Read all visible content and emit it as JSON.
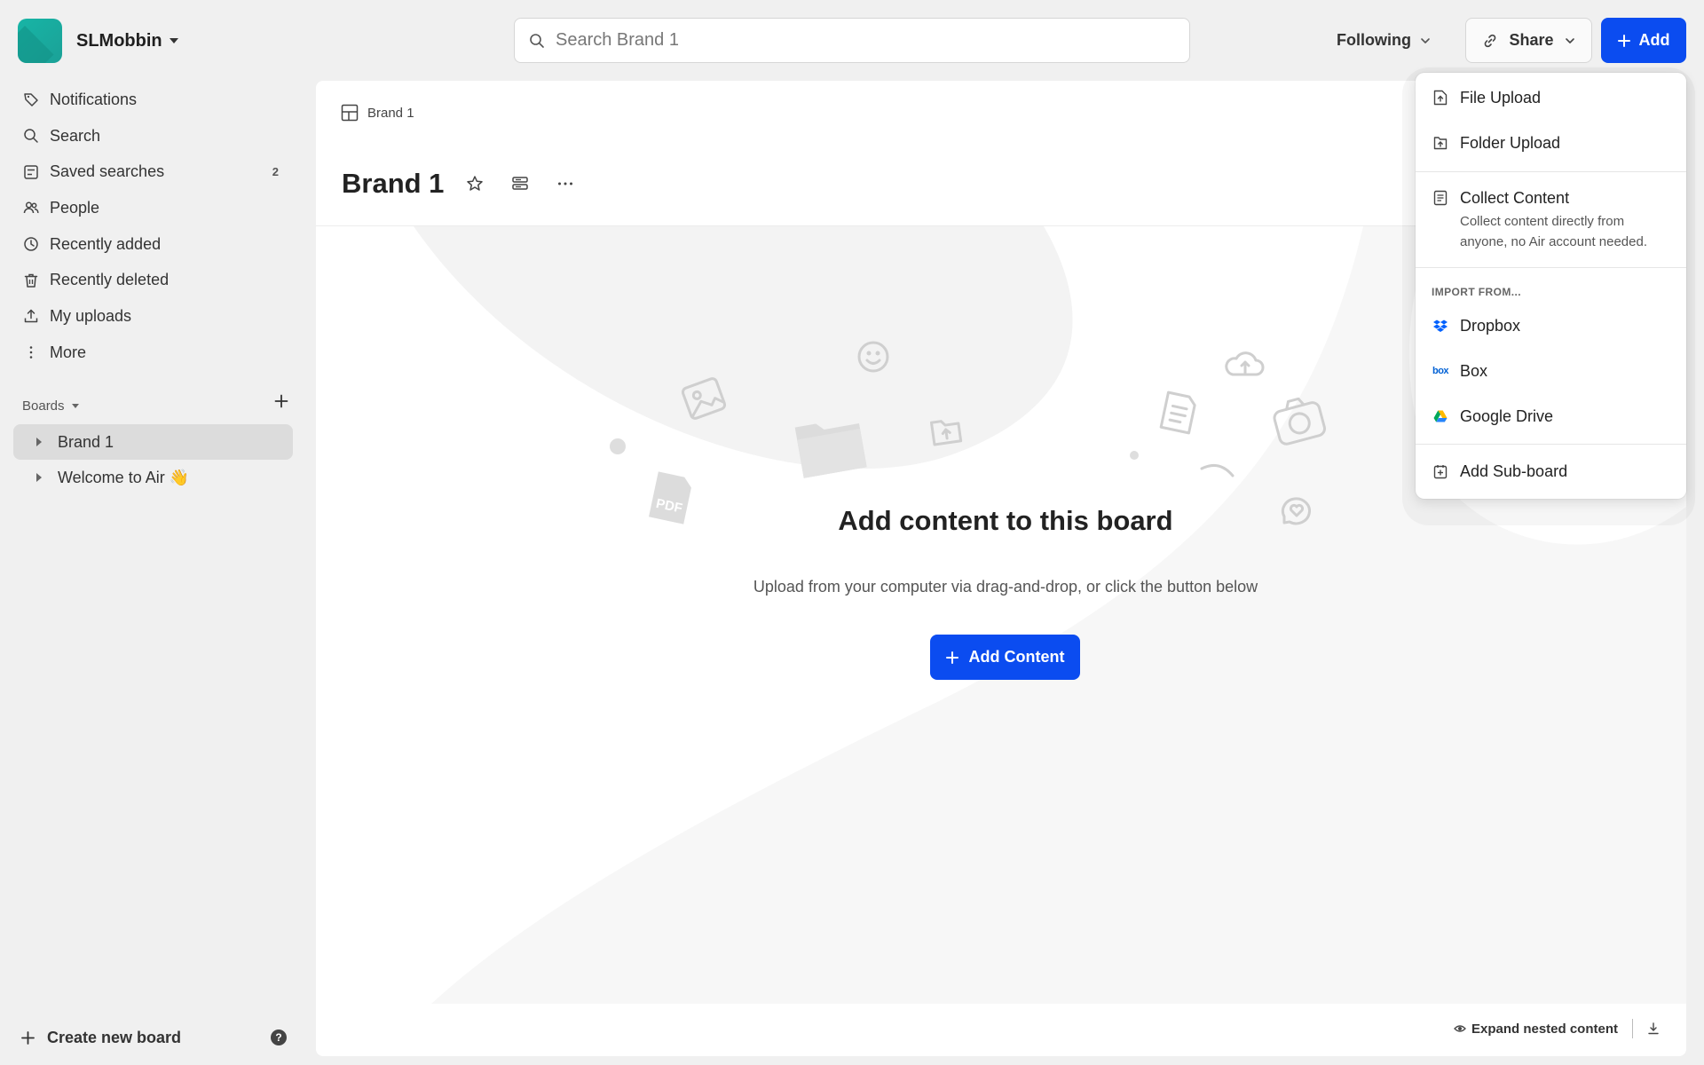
{
  "workspace": {
    "name": "SLMobbin"
  },
  "search": {
    "placeholder": "Search Brand 1"
  },
  "header": {
    "following_label": "Following",
    "share_label": "Share",
    "add_label": "Add"
  },
  "sidebar": {
    "items": [
      {
        "label": "Notifications",
        "icon": "notification-tag-icon"
      },
      {
        "label": "Search",
        "icon": "search-icon"
      },
      {
        "label": "Saved searches",
        "icon": "saved-search-icon",
        "count": "2"
      },
      {
        "label": "People",
        "icon": "people-icon"
      },
      {
        "label": "Recently added",
        "icon": "clock-icon"
      },
      {
        "label": "Recently deleted",
        "icon": "trash-icon"
      },
      {
        "label": "My uploads",
        "icon": "upload-icon"
      },
      {
        "label": "More",
        "icon": "more-vertical-icon"
      }
    ],
    "boards_label": "Boards",
    "boards": [
      {
        "label": "Brand 1",
        "active": true
      },
      {
        "label": "Welcome to Air 👋",
        "active": false
      }
    ],
    "create_board_label": "Create new board",
    "help_label": "?"
  },
  "main": {
    "breadcrumb": "Brand 1",
    "title": "Brand 1",
    "empty": {
      "title": "Add content to this board",
      "subtitle": "Upload from your computer via drag-and-drop, or click the button below",
      "button_label": "Add Content"
    },
    "expand_label": "Expand nested content"
  },
  "menu": {
    "file_upload": "File Upload",
    "folder_upload": "Folder Upload",
    "collect_content": "Collect Content",
    "collect_content_desc": "Collect content directly from anyone, no Air account needed.",
    "import_heading": "IMPORT FROM...",
    "dropbox": "Dropbox",
    "box": "Box",
    "box_logo_text": "box",
    "google_drive": "Google Drive",
    "add_subboard": "Add Sub-board"
  },
  "colors": {
    "accent": "#0b4cf0",
    "logo": "#17b5a6",
    "dropbox": "#0061fe",
    "sidebar_active": "#dcdcdc"
  }
}
